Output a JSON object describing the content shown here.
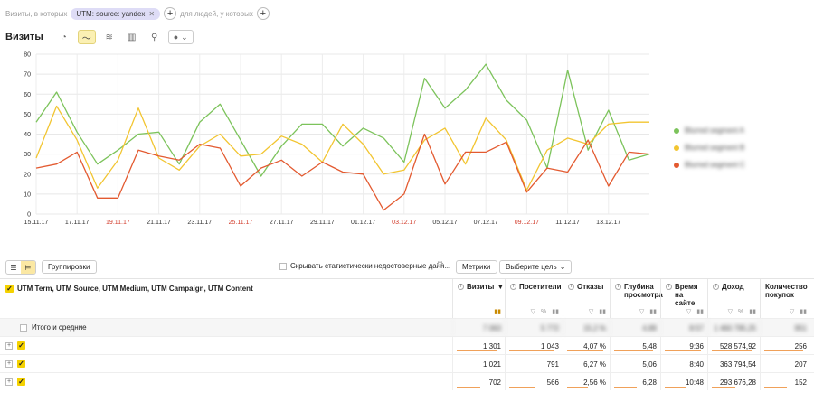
{
  "filter": {
    "visits_where": "Визиты, в которых",
    "chip_label": "UTM: source: yandex",
    "people_where": "для людей, у которых"
  },
  "toolbar": {
    "title": "Визиты"
  },
  "chart_data": {
    "type": "line",
    "x": [
      "15.11.17",
      "16.11.17",
      "17.11.17",
      "18.11.17",
      "19.11.17",
      "20.11.17",
      "21.11.17",
      "22.11.17",
      "23.11.17",
      "24.11.17",
      "25.11.17",
      "26.11.17",
      "27.11.17",
      "28.11.17",
      "29.11.17",
      "30.11.17",
      "01.12.17",
      "02.12.17",
      "03.12.17",
      "04.12.17",
      "05.12.17",
      "06.12.17",
      "07.12.17",
      "08.12.17",
      "09.12.17",
      "10.12.17",
      "11.12.17",
      "12.12.17",
      "13.12.17",
      "14.12.17",
      "15.12.17"
    ],
    "xticks": [
      "15.11.17",
      "17.11.17",
      "19.11.17",
      "21.11.17",
      "23.11.17",
      "25.11.17",
      "27.11.17",
      "29.11.17",
      "01.12.17",
      "03.12.17",
      "05.12.17",
      "07.12.17",
      "09.12.17",
      "11.12.17",
      "13.12.17"
    ],
    "weekend_ticks": [
      "19.11.17",
      "25.11.17",
      "03.12.17",
      "09.12.17"
    ],
    "yticks": [
      0,
      10,
      20,
      30,
      40,
      50,
      60,
      70,
      80
    ],
    "ylim": [
      0,
      80
    ],
    "series": [
      {
        "color": "#7cc35b",
        "values": [
          46,
          61,
          41,
          25,
          32,
          40,
          41,
          25,
          46,
          55,
          37,
          19,
          34,
          45,
          45,
          34,
          43,
          38,
          26,
          68,
          53,
          62,
          75,
          57,
          47,
          23,
          72,
          32,
          52,
          27,
          30
        ]
      },
      {
        "color": "#f2c531",
        "values": [
          28,
          54,
          37,
          13,
          27,
          53,
          28,
          22,
          34,
          40,
          29,
          30,
          39,
          35,
          26,
          45,
          35,
          20,
          22,
          37,
          43,
          25,
          48,
          37,
          12,
          32,
          38,
          35,
          45,
          46,
          46
        ]
      },
      {
        "color": "#e35a30",
        "values": [
          23,
          25,
          31,
          8,
          8,
          32,
          29,
          27,
          35,
          33,
          14,
          23,
          27,
          19,
          26,
          21,
          20,
          2,
          10,
          40,
          15,
          31,
          31,
          36,
          11,
          23,
          21,
          37,
          14,
          31,
          30
        ]
      }
    ]
  },
  "legend": {
    "items": [
      {
        "label": "Blurred segment A",
        "color": "#7cc35b"
      },
      {
        "label": "Blurred segment B",
        "color": "#f2c531"
      },
      {
        "label": "Blurred segment C",
        "color": "#e35a30"
      }
    ]
  },
  "table_toolbar": {
    "groupings": "Группировки",
    "hide_unreliable": "Скрывать статистически недостоверные данн...",
    "metrics": "Метрики",
    "choose_goal": "Выберите цель"
  },
  "table": {
    "dimension_header": "UTM Term, UTM Source, UTM Medium, UTM Campaign, UTM Content",
    "totals_label": "Итого и средние",
    "columns": [
      {
        "label": "Визиты",
        "sort": "▼"
      },
      {
        "label": "Посетители"
      },
      {
        "label": "Отказы"
      },
      {
        "label": "Глубина просмотра"
      },
      {
        "label": "Время на сайте"
      },
      {
        "label": "Доход"
      },
      {
        "label": "Количество покупок"
      }
    ],
    "rows": [
      {
        "label": "Blurred row 1",
        "values": [
          "1 301",
          "1 043",
          "4,07 %",
          "5,48",
          "9:36",
          "528 574,92",
          "256"
        ]
      },
      {
        "label": "Blurred row 2",
        "values": [
          "1 021",
          "791",
          "6,27 %",
          "5,06",
          "8:40",
          "363 794,54",
          "207"
        ]
      },
      {
        "label": "Blurred row 3",
        "values": [
          "702",
          "566",
          "2,56 %",
          "6,28",
          "10:48",
          "293 676,28",
          "152"
        ]
      }
    ]
  }
}
